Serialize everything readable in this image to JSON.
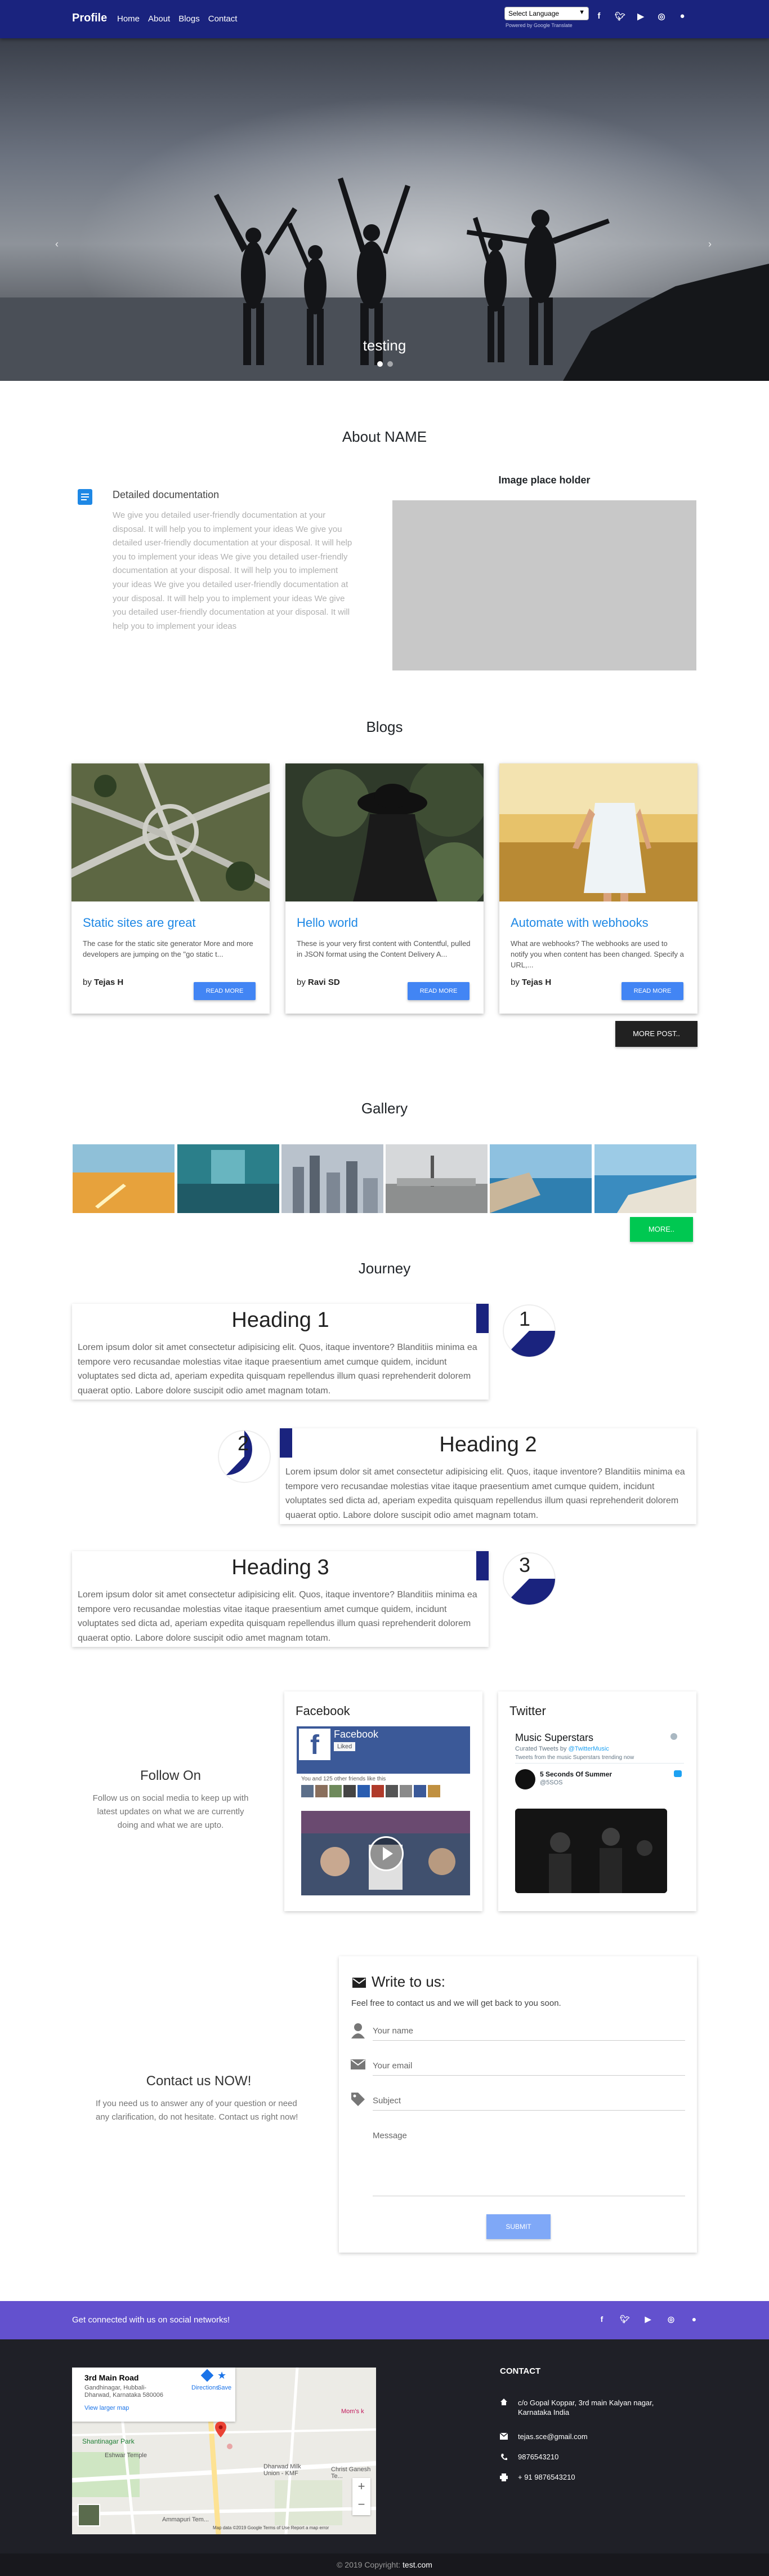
{
  "navbar": {
    "brand": "Profile",
    "links": [
      "Home",
      "About",
      "Blogs",
      "Contact"
    ],
    "language_select": "Select Language",
    "powered_by": "Powered by Google Translate",
    "social_icons": [
      "facebook-icon",
      "twitter-icon",
      "youtube-icon",
      "instagram-icon",
      "github-icon"
    ]
  },
  "hero": {
    "caption": "testing",
    "slides": 2
  },
  "about": {
    "title": "About NAME",
    "doc_title": "Detailed documentation",
    "doc_text": "We give you detailed user-friendly documentation at your disposal. It will help you to implement your ideas We give you detailed user-friendly documentation at your disposal. It will help you to implement your ideas We give you detailed user-friendly documentation at your disposal. It will help you to implement your ideas We give you detailed user-friendly documentation at your disposal. It will help you to implement your ideas We give you detailed user-friendly documentation at your disposal. It will help you to implement your ideas",
    "image_placeholder_title": "Image place holder"
  },
  "blogs": {
    "title": "Blogs",
    "posts": [
      {
        "title": "Static sites are great",
        "excerpt": "The case for the static site generator More and more developers are jumping on the \"go static t...",
        "by": "by ",
        "author": "Tejas H",
        "button": "READ MORE"
      },
      {
        "title": "Hello world",
        "excerpt": "These is your very first content with Contentful, pulled in JSON format using the Content Delivery A...",
        "by": "by ",
        "author": "Ravi SD",
        "button": "READ MORE"
      },
      {
        "title": "Automate with webhooks",
        "excerpt": "What are webhooks? The webhooks are used to notify you when content has been changed. Specify a URL,...",
        "by": "by ",
        "author": "Tejas H",
        "button": "READ MORE"
      }
    ],
    "more_button": "MORE POST.."
  },
  "gallery": {
    "title": "Gallery",
    "more_button": "MORE.."
  },
  "journey": {
    "title": "Journey",
    "items": [
      {
        "heading": "Heading 1",
        "number": "1",
        "text": "Lorem ipsum dolor sit amet consectetur adipisicing elit. Quos, itaque inventore? Blanditiis minima ea tempore vero recusandae molestias vitae itaque praesentium amet cumque quidem, incidunt voluptates sed dicta ad, aperiam expedita quisquam repellendus illum quasi reprehenderit dolorem quaerat optio. Labore dolore suscipit odio amet magnam totam."
      },
      {
        "heading": "Heading 2",
        "number": "2",
        "text": "Lorem ipsum dolor sit amet consectetur adipisicing elit. Quos, itaque inventore? Blanditiis minima ea tempore vero recusandae molestias vitae itaque praesentium amet cumque quidem, incidunt voluptates sed dicta ad, aperiam expedita quisquam repellendus illum quasi reprehenderit dolorem quaerat optio. Labore dolore suscipit odio amet magnam totam."
      },
      {
        "heading": "Heading 3",
        "number": "3",
        "text": "Lorem ipsum dolor sit amet consectetur adipisicing elit. Quos, itaque inventore? Blanditiis minima ea tempore vero recusandae molestias vitae itaque praesentium amet cumque quidem, incidunt voluptates sed dicta ad, aperiam expedita quisquam repellendus illum quasi reprehenderit dolorem quaerat optio. Labore dolore suscipit odio amet magnam totam."
      }
    ]
  },
  "follow": {
    "title": "Follow On",
    "text": "Follow us on social media to keep up with latest updates on what we are currently doing and what we are upto.",
    "facebook": {
      "title": "Facebook",
      "page_name": "Facebook",
      "liked": "Liked",
      "likes_text": "You and 125 other friends like this"
    },
    "twitter": {
      "title": "Twitter",
      "list_name": "Music Superstars",
      "curated": "Curated Tweets by",
      "curator": "@TwitterMusic",
      "tweets_from": "Tweets from the music Superstars trending now",
      "account": "5 Seconds Of Summer",
      "handle": "@5SOS"
    }
  },
  "contact": {
    "title": "Contact us NOW!",
    "text": "If you need us to answer any of your question or need any clarification, do not hesitate. Contact us right now!",
    "form_title": "Write to us:",
    "form_lead": "Feel free to contact us and we will get back to you soon.",
    "fields": {
      "name": "Your name",
      "email": "Your email",
      "subject": "Subject",
      "message": "Message"
    },
    "submit": "SUBMIT"
  },
  "footer": {
    "social_text": "Get connected with us on social networks!",
    "contact_title": "CONTACT",
    "address": "c/o Gopal Koppar, 3rd main Kalyan nagar, Karnataka India",
    "email": "tejas.sce@gmail.com",
    "phone1": "9876543210",
    "phone2": "+ 91 9876543210",
    "copyright": "© 2019 Copyright: ",
    "site": "test.com",
    "map": {
      "place_title": "3rd Main Road",
      "place_address": "Gandhinagar, Hubbali-Dharwad, Karnataka 580006",
      "larger_map": "View larger map",
      "directions": "Directions",
      "save": "Save",
      "park": "Shantinagar Park",
      "temple": "Eshwar Temple",
      "mall": "Dharwad Milk Union - KMF",
      "church": "Christ Ganesh Te...",
      "area": "Ammapuri Tem...",
      "moms": "Mom's k",
      "attribution": "Map data ©2019 Google   Terms of Use   Report a map error"
    }
  },
  "colors": {
    "navbar": "#1a237e",
    "accent_blue": "#1e88e5",
    "footer_bar": "#6351ce",
    "green": "#00c851"
  }
}
